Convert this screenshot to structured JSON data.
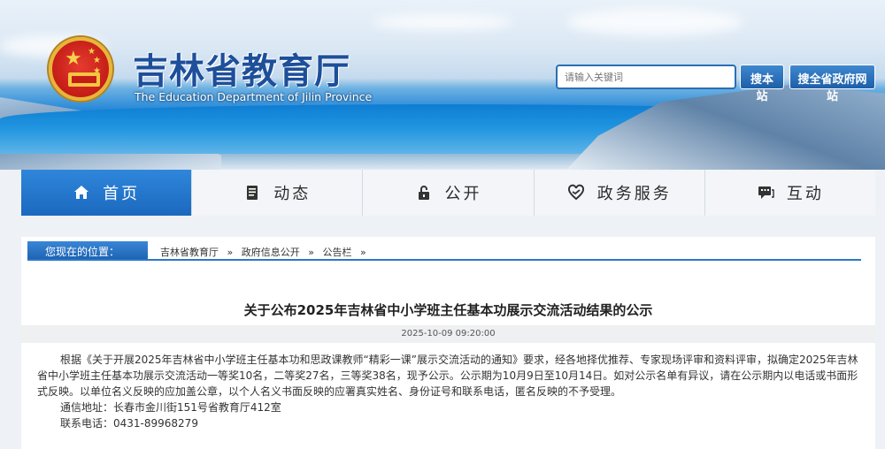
{
  "header": {
    "title": "吉林省教育厅",
    "subtitle": "The Education Department of Jilin Province",
    "search_placeholder": "请输入关键词",
    "search_site_label": "搜本站",
    "search_province_label": "搜全省政府网站"
  },
  "nav": {
    "items": [
      {
        "label": "首页",
        "icon": "home-icon"
      },
      {
        "label": "动态",
        "icon": "news-icon"
      },
      {
        "label": "公开",
        "icon": "lock-icon"
      },
      {
        "label": "政务服务",
        "icon": "service-icon"
      },
      {
        "label": "互动",
        "icon": "chat-icon"
      }
    ],
    "active_index": 0,
    "active_color": "#1b69bf"
  },
  "breadcrumb": {
    "label": "您现在的位置：",
    "items": [
      "吉林省教育厅",
      "政府信息公开",
      "公告栏"
    ],
    "separator": "»"
  },
  "article": {
    "title": "关于公布2025年吉林省中小学班主任基本功展示交流活动结果的公示",
    "date": "2025-10-09 09:20:00",
    "paragraph": "根据《关于开展2025年吉林省中小学班主任基本功和思政课教师“精彩一课”展示交流活动的通知》要求，经各地择优推荐、专家现场评审和资料评审，拟确定2025年吉林省中小学班主任基本功展示交流活动一等奖10名，二等奖27名，三等奖38名，现予公示。公示期为10月9日至10月14日。如对公示名单有异议，请在公示期内以电话或书面形式反映。以单位名义反映的应加盖公章，以个人名义书面反映的应署真实姓名、身份证号和联系电话，匿名反映的不予受理。",
    "address": "通信地址：长春市金川街151号省教育厅412室",
    "phone": "联系电话：0431-89968279"
  }
}
